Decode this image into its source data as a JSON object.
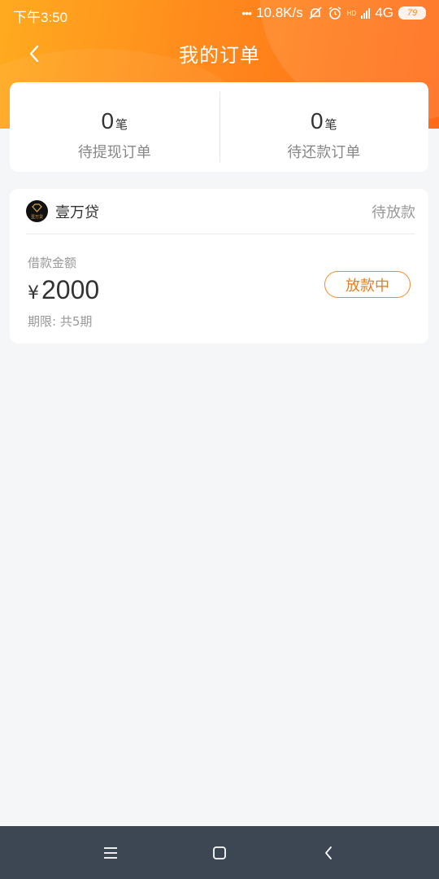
{
  "status_bar": {
    "time": "下午3:50",
    "net_speed": "10.8K/s",
    "network": "4G",
    "hd": "HD",
    "battery": "79"
  },
  "header": {
    "title": "我的订单"
  },
  "summary": {
    "withdraw": {
      "count": "0",
      "unit": "笔",
      "label": "待提现订单"
    },
    "repay": {
      "count": "0",
      "unit": "笔",
      "label": "待还款订单"
    }
  },
  "order": {
    "company": "壹万贷",
    "logo_text": "壹万贷",
    "status": "待放款",
    "amount_label": "借款金额",
    "currency": "¥",
    "amount": "2000",
    "term": "期限: 共5期",
    "action": "放款中"
  },
  "colors": {
    "accent": "#ff8a1c",
    "button_border": "#f08a30",
    "nav_bg": "#3c4753"
  }
}
